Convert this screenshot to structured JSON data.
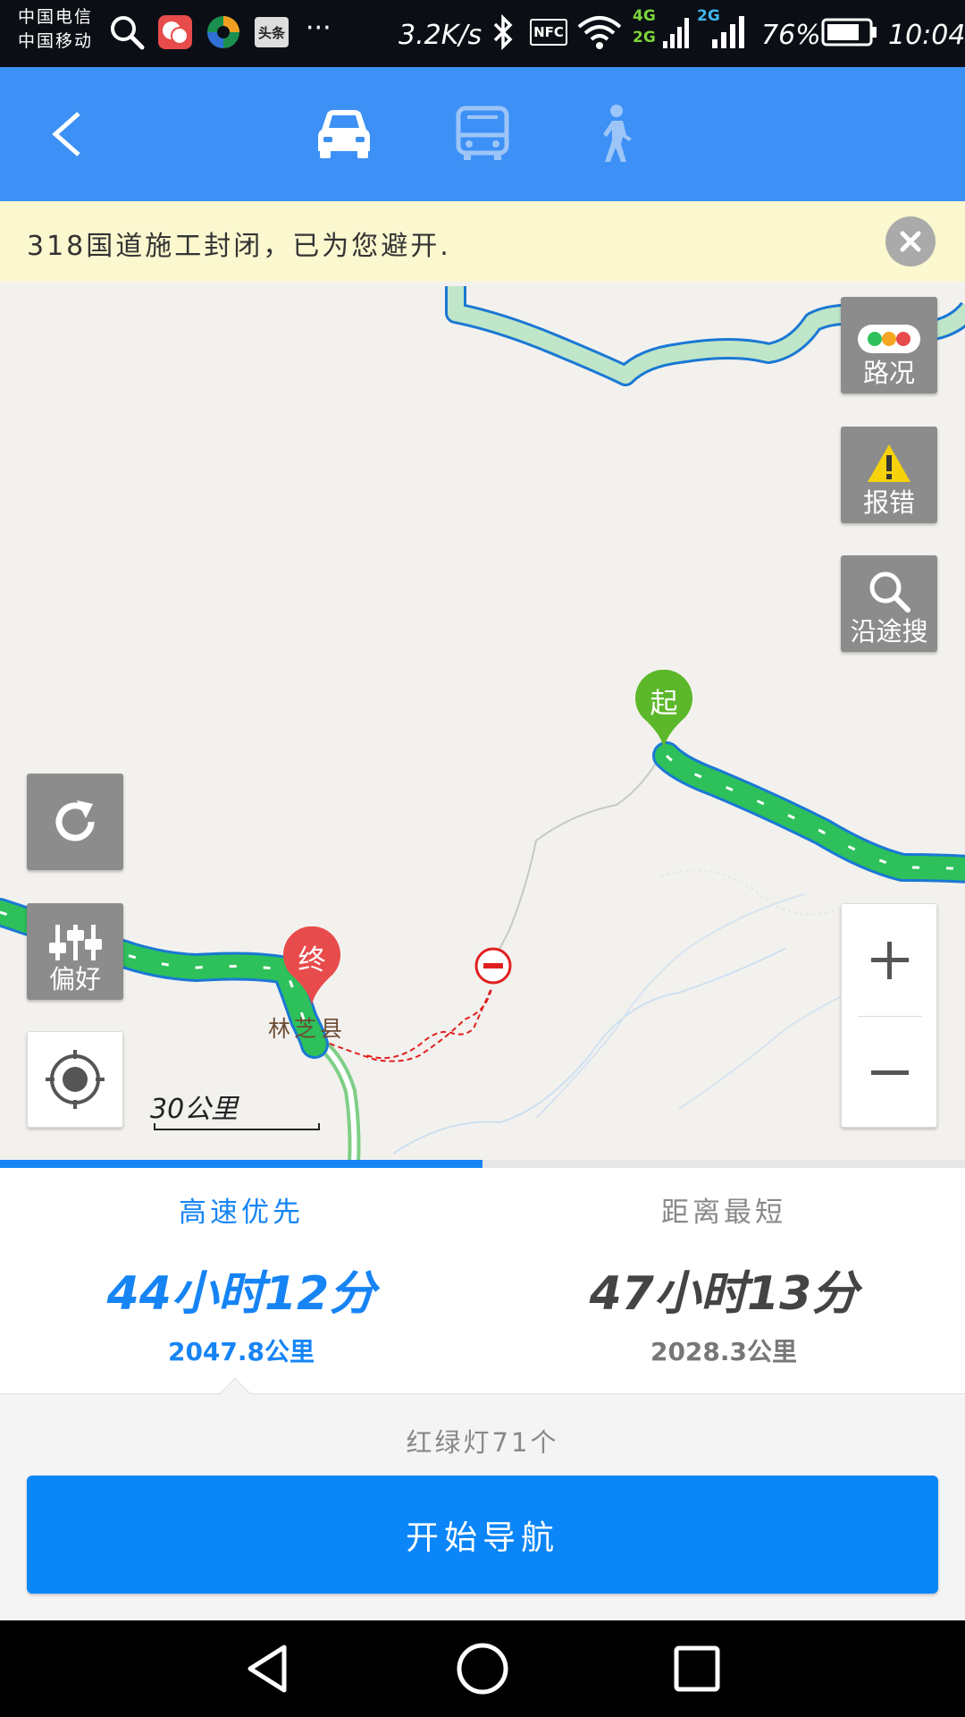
{
  "status_bar": {
    "carrier_1": "中国电信",
    "carrier_2": "中国移动",
    "speed": "3.2K/s",
    "nfc": "NFC",
    "net_4g": "4G",
    "net_2g_a": "2G",
    "net_2g_b": "2G",
    "battery": "76%",
    "time": "10:04",
    "more": "···",
    "toutiao": "头条"
  },
  "app_bar": {
    "modes": [
      "car",
      "bus",
      "walk"
    ],
    "active_mode": "car"
  },
  "banner": {
    "text": "318国道施工封闭，已为您避开."
  },
  "map": {
    "buttons": {
      "traffic": "路况",
      "report": "报错",
      "search_along": "沿途搜",
      "preference": "偏好"
    },
    "start_marker": "起",
    "end_marker": "终",
    "place_label": "林芝县",
    "scale": "30公里"
  },
  "route_progress": 0.5,
  "routes": [
    {
      "name": "高速优先",
      "time": "44小时12分",
      "distance": "2047.8公里",
      "selected": true
    },
    {
      "name": "距离最短",
      "time": "47小时13分",
      "distance": "2028.3公里",
      "selected": false
    }
  ],
  "traffic_lights": "红绿灯71个",
  "start_button": "开始导航",
  "colors": {
    "accent": "#3d90f5",
    "button": "#0b86f8",
    "route_green": "#2ec05a",
    "route_border": "#1a78d4",
    "start_pin": "#5cb82a",
    "end_pin": "#e84b4b"
  }
}
